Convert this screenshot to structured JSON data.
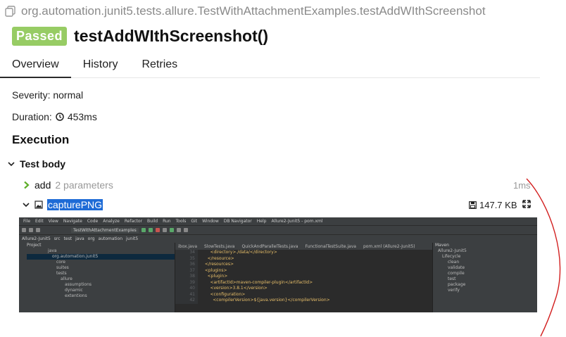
{
  "header": {
    "full_name": "org.automation.junit5.tests.allure.TestWithAttachmentExamples.testAddWIthScreenshot",
    "status": "Passed",
    "title": "testAddWIthScreenshot()"
  },
  "tabs": [
    "Overview",
    "History",
    "Retries"
  ],
  "overview": {
    "severity": "Severity: normal",
    "duration_label": "Duration:",
    "duration_value": "453ms",
    "execution_heading": "Execution",
    "test_body": "Test body",
    "step_name": "add",
    "step_params": "2 parameters",
    "step_time": "1ms",
    "attachment_name": "capturePNG",
    "attachment_size": "147.7 KB"
  },
  "colors": {
    "passed": "#97cc64",
    "selection": "#1e6bd6"
  },
  "screenshot": {
    "menu": [
      "File",
      "Edit",
      "View",
      "Navigate",
      "Code",
      "Analyze",
      "Refactor",
      "Build",
      "Run",
      "Tools",
      "Git",
      "Window",
      "DB Navigator",
      "Help",
      "Allure2-Junit5 - pom.xml"
    ],
    "breadcrumb": [
      "Allure2-Junit5",
      "src",
      "test",
      "java",
      "org",
      "automation",
      "junit5"
    ],
    "run_config": "TestWithAttachmentExamples",
    "project_label": "Project",
    "project_tree": [
      "java",
      "org.automation.junit5",
      "core",
      "suites",
      "tests",
      "allure",
      "assumptions",
      "dynamic",
      "extentions"
    ],
    "editor_tabs": [
      "ibox.java",
      "SlowTests.java",
      "QuickAndParallelTests.java",
      "FunctionalTestSuite.java",
      "pom.xml (Allure2-Junit5)"
    ],
    "line_numbers": [
      "34",
      "35",
      "36",
      "37",
      "38",
      "39",
      "40",
      "41",
      "42"
    ],
    "code_lines": [
      "      <directory>./data/</directory>",
      "    </resource>",
      "  </resources>",
      "  <plugins>",
      "    <plugin>",
      "      <artifactId>maven-compiler-plugin</artifactId>",
      "      <version>3.8.1</version>",
      "      <configuration>",
      "        <compilerVersion>${java.version}</compilerVersion>"
    ],
    "maven_label": "Maven",
    "maven_tree": [
      "Allure2-Junit5",
      "Lifecycle",
      "clean",
      "validate",
      "compile",
      "test",
      "package",
      "verify"
    ]
  }
}
